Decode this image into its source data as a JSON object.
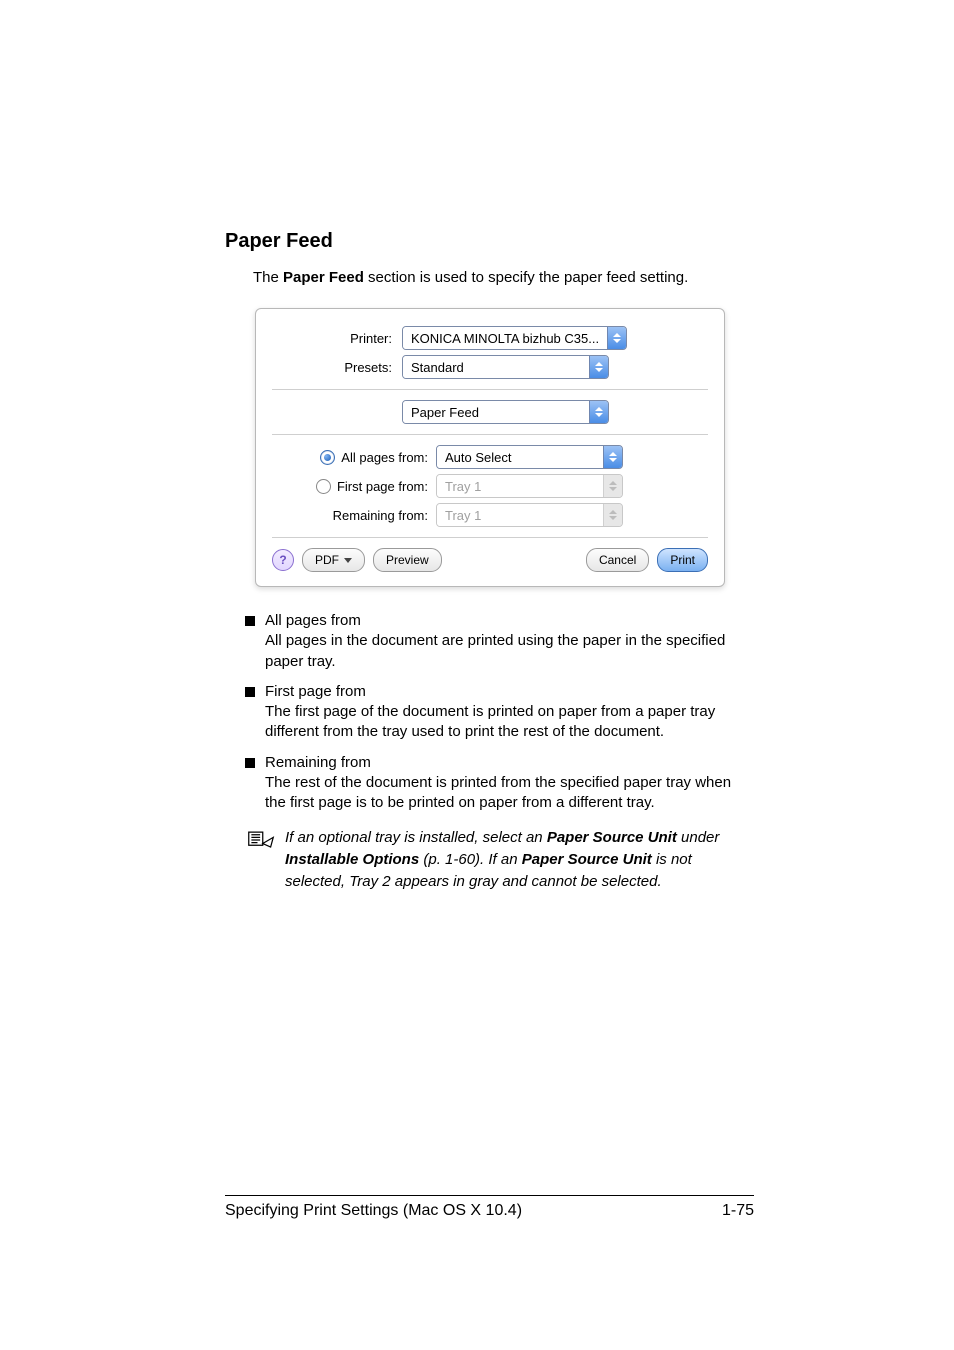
{
  "heading": "Paper Feed",
  "intro_pre": "The ",
  "intro_bold": "Paper Feed",
  "intro_post": " section is used to specify the paper feed setting.",
  "dialog": {
    "printer_label": "Printer:",
    "printer_value": "KONICA MINOLTA bizhub C35...",
    "presets_label": "Presets:",
    "presets_value": "Standard",
    "section_value": "Paper Feed",
    "all_pages_label": "All pages from:",
    "all_pages_value": "Auto Select",
    "first_page_label": "First page from:",
    "first_page_value": "Tray 1",
    "remaining_label": "Remaining from:",
    "remaining_value": "Tray 1",
    "pdf_label": "PDF",
    "preview_label": "Preview",
    "cancel_label": "Cancel",
    "print_label": "Print",
    "help_label": "?"
  },
  "items": [
    {
      "title": "All pages from",
      "desc": "All pages in the document are printed using the paper in the specified paper tray."
    },
    {
      "title": "First page from",
      "desc": "The first page of the document is printed on paper from a paper tray different from the tray used to print the rest of the document."
    },
    {
      "title": "Remaining from",
      "desc": "The rest of the document is printed from the specified paper tray when the first page is to be printed on paper from a different tray."
    }
  ],
  "note": {
    "pre": "If an optional tray is installed, select an ",
    "b1": "Paper Source Unit",
    "mid1": " under ",
    "b2": "Installable Options",
    "mid2": " (p. 1-60). If an ",
    "b3": "Paper Source Unit",
    "post": " is not selected, Tray 2 appears in gray and cannot be selected."
  },
  "footer": {
    "left": "Specifying Print Settings (Mac OS X 10.4)",
    "right": "1-75"
  },
  "chart_data": {
    "type": "table",
    "note": "no chart present"
  }
}
